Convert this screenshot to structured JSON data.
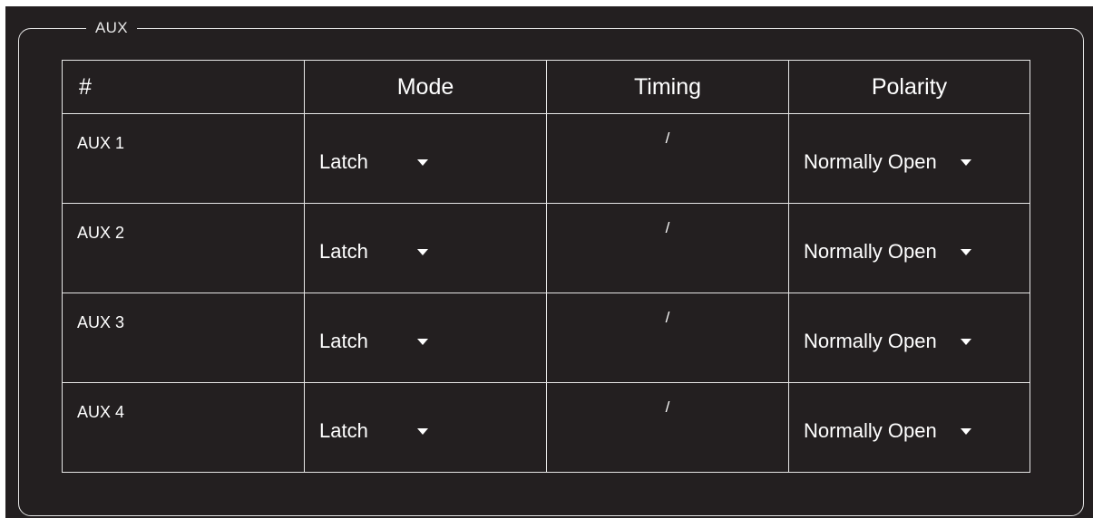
{
  "group": {
    "legend": "AUX"
  },
  "table": {
    "headers": {
      "num": "#",
      "mode": "Mode",
      "timing": "Timing",
      "polarity": "Polarity"
    },
    "rows": [
      {
        "label": "AUX 1",
        "mode": "Latch",
        "timing": "/",
        "polarity": "Normally Open"
      },
      {
        "label": "AUX 2",
        "mode": "Latch",
        "timing": "/",
        "polarity": "Normally Open"
      },
      {
        "label": "AUX 3",
        "mode": "Latch",
        "timing": "/",
        "polarity": "Normally Open"
      },
      {
        "label": "AUX 4",
        "mode": "Latch",
        "timing": "/",
        "polarity": "Normally Open"
      }
    ]
  },
  "icons": {
    "dropdown": "caret-down-icon"
  },
  "colors": {
    "background": "#231f20",
    "border": "#e6e6e6",
    "text": "#ffffff"
  }
}
